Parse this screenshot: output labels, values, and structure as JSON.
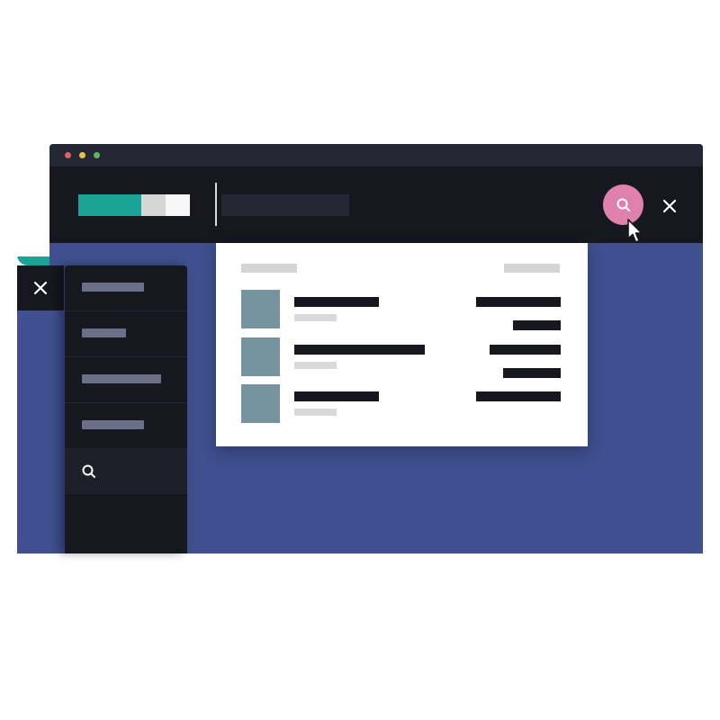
{
  "colors": {
    "accent": "#e081ad",
    "brand": "#1ba397",
    "toolbar": "#16171f",
    "page_bg": "#3f4f8f",
    "thumb": "#7594a0"
  },
  "titlebar": {
    "dots": [
      {
        "color": "#e05f5f",
        "icon": "window-close-dot"
      },
      {
        "color": "#e8c33d",
        "icon": "window-minimize-dot"
      },
      {
        "color": "#5cb85c",
        "icon": "window-maximize-dot"
      }
    ]
  },
  "search": {
    "value": "",
    "placeholder": ""
  },
  "icons": {
    "search": "search-icon",
    "close": "close-icon",
    "cursor": "cursor-icon"
  },
  "sidebar": {
    "items": [
      {
        "label": "",
        "bar_fraction": 0.62
      },
      {
        "label": "",
        "bar_fraction": 0.45
      },
      {
        "label": "",
        "bar_fraction": 0.78
      },
      {
        "label": "",
        "bar_fraction": 0.62
      }
    ]
  },
  "results": {
    "header_left": "",
    "header_right": "",
    "items": [
      {
        "title": "",
        "subtitle": "",
        "price": "",
        "price_sub": ""
      },
      {
        "title": "",
        "subtitle": "",
        "price": "",
        "price_sub": ""
      },
      {
        "title": "",
        "subtitle": "",
        "price": "",
        "price_sub": ""
      }
    ]
  }
}
